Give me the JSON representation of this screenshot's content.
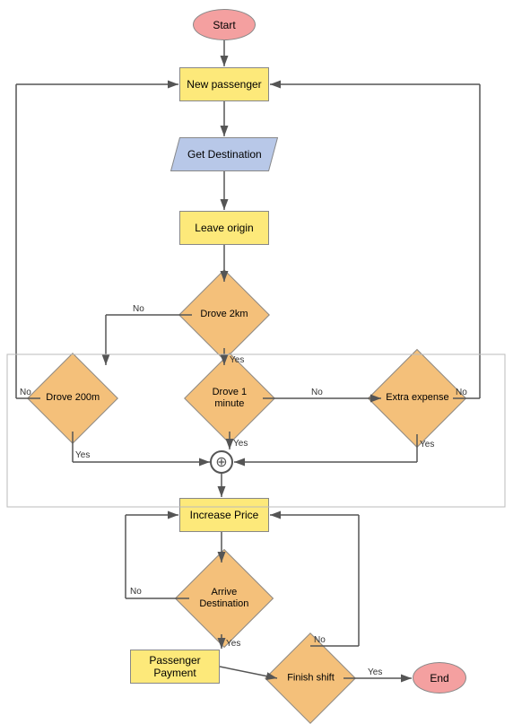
{
  "nodes": {
    "start": {
      "label": "Start"
    },
    "new_passenger": {
      "label": "New passenger"
    },
    "get_destination": {
      "label": "Get Destination"
    },
    "leave_origin": {
      "label": "Leave origin"
    },
    "drove_2km": {
      "label": "Drove 2km"
    },
    "drove_200m": {
      "label": "Drove 200m"
    },
    "drove_1min": {
      "label": "Drove 1 minute"
    },
    "extra_expense": {
      "label": "Extra expense"
    },
    "increase_price": {
      "label": "Increase Price"
    },
    "arrive_destination": {
      "label": "Arrive Destination"
    },
    "passenger_payment": {
      "label": "Passenger Payment"
    },
    "finish_shift": {
      "label": "Finish shift"
    },
    "end": {
      "label": "End"
    }
  },
  "labels": {
    "yes": "Yes",
    "no": "No"
  }
}
